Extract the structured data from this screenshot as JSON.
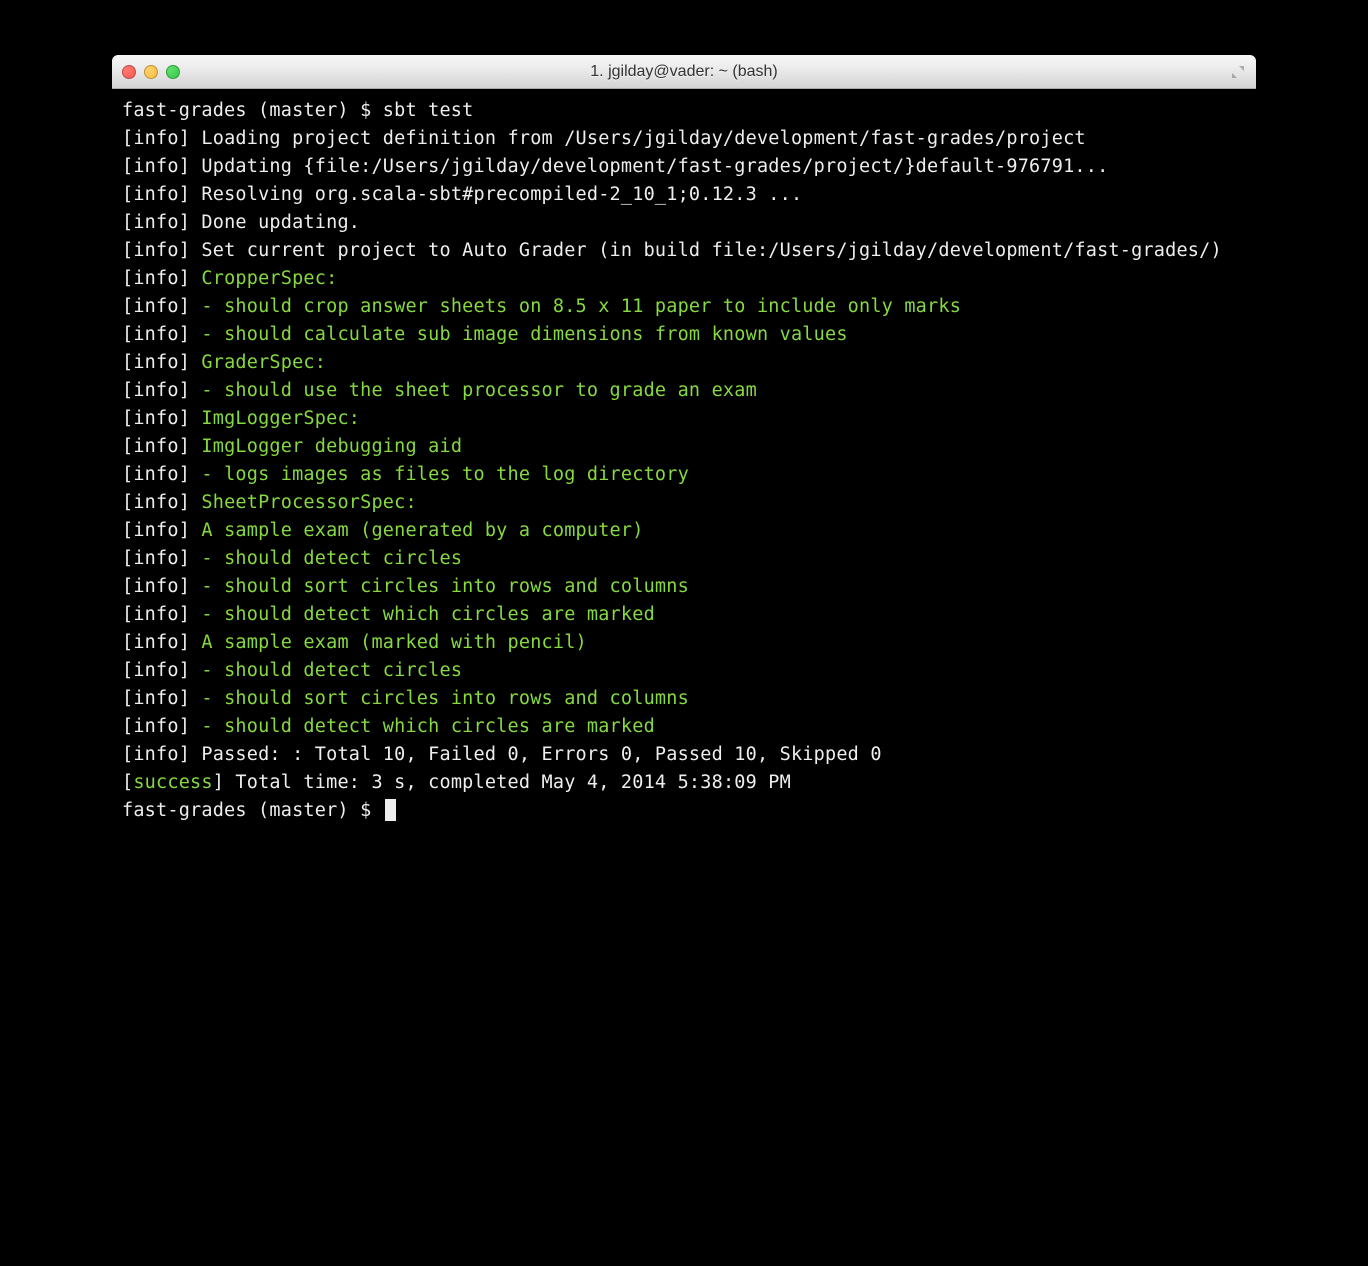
{
  "window": {
    "title": "1. jgilday@vader: ~ (bash)"
  },
  "prompt1": "fast-grades (master) $ ",
  "command": "sbt test",
  "lines": [
    {
      "tag": "info",
      "colored": false,
      "text": "Loading project definition from /Users/jgilday/development/fast-grades/project"
    },
    {
      "tag": "info",
      "colored": false,
      "text": "Updating {file:/Users/jgilday/development/fast-grades/project/}default-976791..."
    },
    {
      "tag": "info",
      "colored": false,
      "text": "Resolving org.scala-sbt#precompiled-2_10_1;0.12.3 ..."
    },
    {
      "tag": "info",
      "colored": false,
      "text": "Done updating."
    },
    {
      "tag": "info",
      "colored": false,
      "text": "Set current project to Auto Grader (in build file:/Users/jgilday/development/fast-grades/)"
    },
    {
      "tag": "info",
      "colored": true,
      "text": "CropperSpec:"
    },
    {
      "tag": "info",
      "colored": true,
      "text": "- should crop answer sheets on 8.5 x 11 paper to include only marks"
    },
    {
      "tag": "info",
      "colored": true,
      "text": "- should calculate sub image dimensions from known values"
    },
    {
      "tag": "info",
      "colored": true,
      "text": "GraderSpec:"
    },
    {
      "tag": "info",
      "colored": true,
      "text": "- should use the sheet processor to grade an exam"
    },
    {
      "tag": "info",
      "colored": true,
      "text": "ImgLoggerSpec:"
    },
    {
      "tag": "info",
      "colored": true,
      "text": "ImgLogger debugging aid"
    },
    {
      "tag": "info",
      "colored": true,
      "text": "- logs images as files to the log directory"
    },
    {
      "tag": "info",
      "colored": true,
      "text": "SheetProcessorSpec:"
    },
    {
      "tag": "info",
      "colored": true,
      "text": "A sample exam (generated by a computer)"
    },
    {
      "tag": "info",
      "colored": true,
      "text": "- should detect circles"
    },
    {
      "tag": "info",
      "colored": true,
      "text": "- should sort circles into rows and columns"
    },
    {
      "tag": "info",
      "colored": true,
      "text": "- should detect which circles are marked"
    },
    {
      "tag": "info",
      "colored": true,
      "text": "A sample exam (marked with pencil)"
    },
    {
      "tag": "info",
      "colored": true,
      "text": "- should detect circles"
    },
    {
      "tag": "info",
      "colored": true,
      "text": "- should sort circles into rows and columns"
    },
    {
      "tag": "info",
      "colored": true,
      "text": "- should detect which circles are marked"
    },
    {
      "tag": "info",
      "colored": false,
      "text": "Passed: : Total 10, Failed 0, Errors 0, Passed 10, Skipped 0"
    }
  ],
  "successLine": {
    "tag": "success",
    "text": "Total time: 3 s, completed May 4, 2014 5:38:09 PM"
  },
  "prompt2": "fast-grades (master) $ "
}
